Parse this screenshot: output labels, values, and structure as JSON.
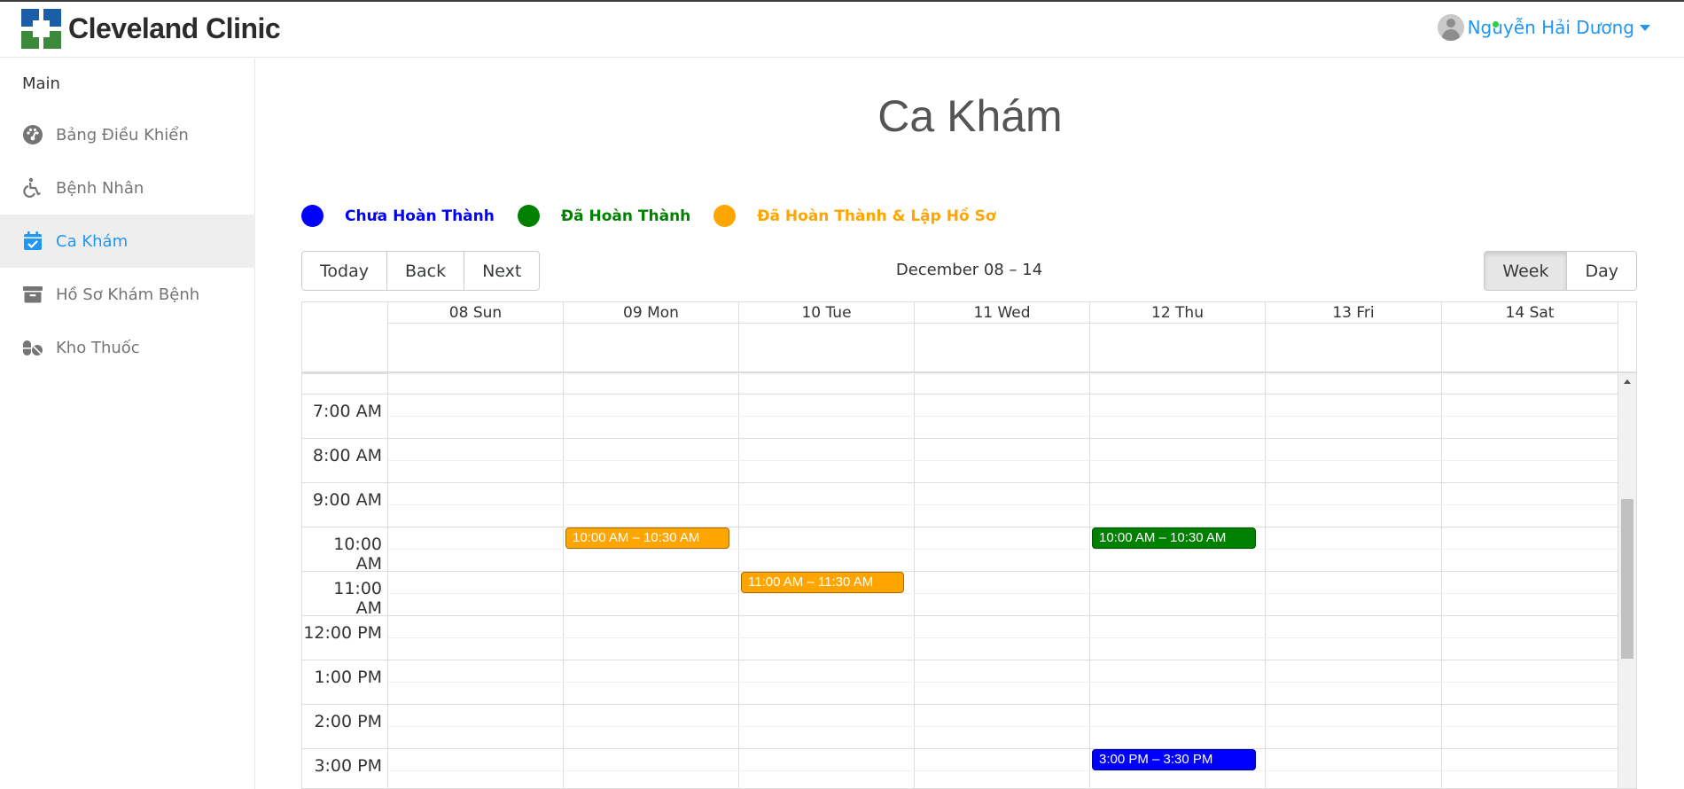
{
  "brand": {
    "name": "Cleveland Clinic",
    "colors": {
      "blue": "#1a5ea8",
      "green": "#3b8a3b"
    }
  },
  "user": {
    "name": "Nguyễn Hải Dương",
    "status_color": "#2ecc40"
  },
  "sidebar": {
    "section_label": "Main",
    "items": [
      {
        "label": "Bảng Điều Khiển",
        "icon": "dashboard-icon",
        "active": false
      },
      {
        "label": "Bệnh Nhân",
        "icon": "wheelchair-icon",
        "active": false
      },
      {
        "label": "Ca Khám",
        "icon": "calendar-check-icon",
        "active": true
      },
      {
        "label": "Hồ Sơ Khám Bệnh",
        "icon": "archive-icon",
        "active": false
      },
      {
        "label": "Kho Thuốc",
        "icon": "pills-icon",
        "active": false
      }
    ]
  },
  "page": {
    "title": "Ca Khám"
  },
  "legend": [
    {
      "label": "Chưa Hoàn Thành",
      "color": "#0000ff"
    },
    {
      "label": "Đã Hoàn Thành",
      "color": "#008000"
    },
    {
      "label": "Đã Hoàn Thành & Lập Hồ Sơ",
      "color": "#ffa500"
    }
  ],
  "toolbar": {
    "nav_buttons": [
      "Today",
      "Back",
      "Next"
    ],
    "range_label": "December 08 – 14",
    "view_buttons": [
      {
        "label": "Week",
        "active": true
      },
      {
        "label": "Day",
        "active": false
      }
    ]
  },
  "calendar": {
    "days": [
      "08 Sun",
      "09 Mon",
      "10 Tue",
      "11 Wed",
      "12 Thu",
      "13 Fri",
      "14 Sat"
    ],
    "times": [
      "7:00 AM",
      "8:00 AM",
      "9:00 AM",
      "10:00 AM",
      "11:00 AM",
      "12:00 PM",
      "1:00 PM",
      "2:00 PM",
      "3:00 PM"
    ],
    "events": [
      {
        "label": "10:00 AM – 10:30 AM",
        "day": 1,
        "start": "10:00 AM",
        "status": "Đã Hoàn Thành & Lập Hồ Sơ",
        "color": "#ffa500"
      },
      {
        "label": "11:00 AM – 11:30 AM",
        "day": 2,
        "start": "11:00 AM",
        "status": "Đã Hoàn Thành & Lập Hồ Sơ",
        "color": "#ffa500"
      },
      {
        "label": "10:00 AM – 10:30 AM",
        "day": 4,
        "start": "10:00 AM",
        "status": "Đã Hoàn Thành",
        "color": "#008000"
      },
      {
        "label": "3:00 PM – 3:30 PM",
        "day": 4,
        "start": "3:00 PM",
        "status": "Chưa Hoàn Thành",
        "color": "#0000ff"
      }
    ]
  }
}
